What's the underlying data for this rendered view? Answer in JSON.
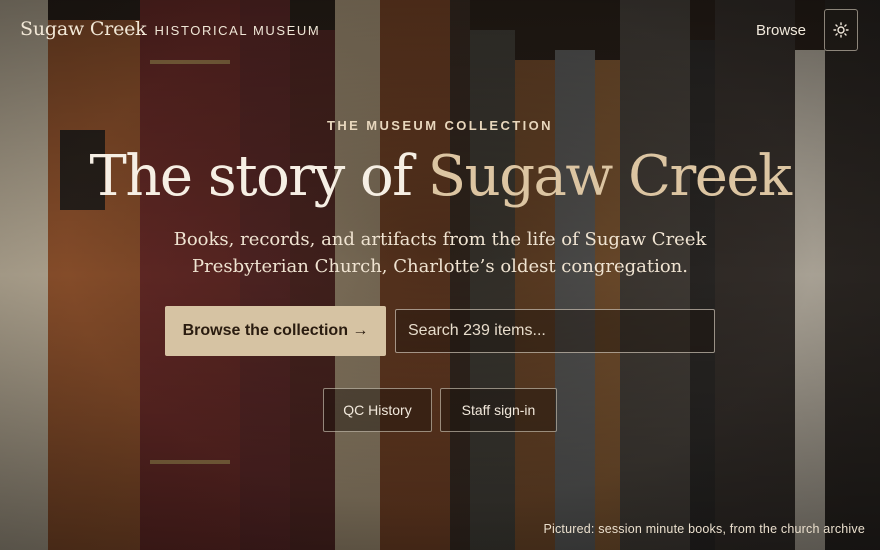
{
  "brand": {
    "name": "Sugaw Creek",
    "subtitle": "HISTORICAL MUSEUM"
  },
  "nav": {
    "browse_label": "Browse",
    "theme_toggle_icon": "sun-icon"
  },
  "hero": {
    "eyebrow": "THE MUSEUM COLLECTION",
    "title_lead": "The story of",
    "title_accent": "Sugaw Creek",
    "lede": "Books, records, and artifacts from the life of Sugaw Creek Presbyterian Church, Charlotte’s oldest congregation."
  },
  "actions": {
    "browse_collection_label": "Browse the collection →",
    "search_placeholder": "Search 239 items...",
    "qc_history_label": "QC History",
    "staff_signin_label": "Staff sign-in"
  },
  "caption": "Pictured: session minute books, from the church archive",
  "colors": {
    "accent": "#dcc5a2",
    "button_fill": "#d6c3a3",
    "text": "#f1e8db"
  }
}
